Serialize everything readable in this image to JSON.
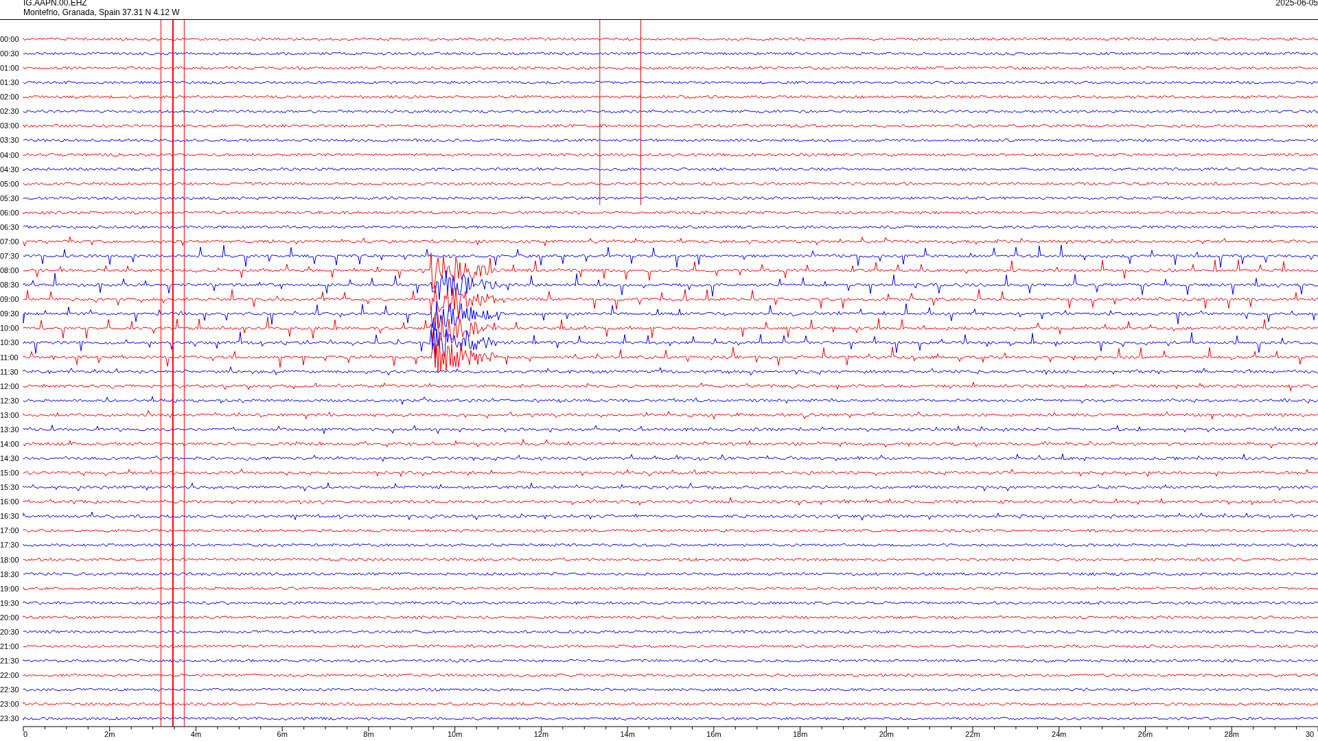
{
  "header": {
    "station": "IG.AAPN.00.EHZ",
    "location": "Montefrio, Granada, Spain  37.31 N 4.12 W",
    "date": "2025-06-05"
  },
  "rows": [
    {
      "label": "00:00",
      "color": "#ff0000"
    },
    {
      "label": "00:30",
      "color": "#0000ff"
    },
    {
      "label": "01:00",
      "color": "#ff0000"
    },
    {
      "label": "01:30",
      "color": "#0000ff"
    },
    {
      "label": "02:00",
      "color": "#ff0000"
    },
    {
      "label": "02:30",
      "color": "#0000ff"
    },
    {
      "label": "03:00",
      "color": "#ff0000"
    },
    {
      "label": "03:30",
      "color": "#0000ff"
    },
    {
      "label": "04:00",
      "color": "#ff0000"
    },
    {
      "label": "04:30",
      "color": "#0000ff"
    },
    {
      "label": "05:00",
      "color": "#ff0000"
    },
    {
      "label": "05:30",
      "color": "#0000ff"
    },
    {
      "label": "06:00",
      "color": "#ff0000"
    },
    {
      "label": "06:30",
      "color": "#0000ff"
    },
    {
      "label": "07:00",
      "color": "#ff0000"
    },
    {
      "label": "07:30",
      "color": "#0000ff"
    },
    {
      "label": "08:00",
      "color": "#ff0000"
    },
    {
      "label": "08:30",
      "color": "#0000ff"
    },
    {
      "label": "09:00",
      "color": "#ff0000"
    },
    {
      "label": "09:30",
      "color": "#0000ff"
    },
    {
      "label": "10:00",
      "color": "#ff0000"
    },
    {
      "label": "10:30",
      "color": "#0000ff"
    },
    {
      "label": "11:00",
      "color": "#ff0000"
    },
    {
      "label": "11:30",
      "color": "#0000ff"
    },
    {
      "label": "12:00",
      "color": "#ff0000"
    },
    {
      "label": "12:30",
      "color": "#0000ff"
    },
    {
      "label": "13:00",
      "color": "#ff0000"
    },
    {
      "label": "13:30",
      "color": "#0000ff"
    },
    {
      "label": "14:00",
      "color": "#ff0000"
    },
    {
      "label": "14:30",
      "color": "#0000ff"
    },
    {
      "label": "15:00",
      "color": "#ff0000"
    },
    {
      "label": "15:30",
      "color": "#0000ff"
    },
    {
      "label": "16:00",
      "color": "#ff0000"
    },
    {
      "label": "16:30",
      "color": "#0000ff"
    },
    {
      "label": "17:00",
      "color": "#ff0000"
    },
    {
      "label": "17:30",
      "color": "#0000ff"
    },
    {
      "label": "18:00",
      "color": "#ff0000"
    },
    {
      "label": "18:30",
      "color": "#0000ff"
    },
    {
      "label": "19:00",
      "color": "#ff0000"
    },
    {
      "label": "19:30",
      "color": "#0000ff"
    },
    {
      "label": "20:00",
      "color": "#ff0000"
    },
    {
      "label": "20:30",
      "color": "#0000ff"
    },
    {
      "label": "21:00",
      "color": "#ff0000"
    },
    {
      "label": "21:30",
      "color": "#0000ff"
    },
    {
      "label": "22:00",
      "color": "#ff0000"
    },
    {
      "label": "22:30",
      "color": "#0000ff"
    },
    {
      "label": "23:00",
      "color": "#ff0000"
    },
    {
      "label": "23:30",
      "color": "#0000ff"
    }
  ],
  "x_axis": {
    "labels": [
      "0",
      "2m",
      "4m",
      "6m",
      "8m",
      "10m",
      "12m",
      "14m",
      "16m",
      "18m",
      "20m",
      "22m",
      "24m",
      "26m",
      "28m",
      "30"
    ]
  }
}
